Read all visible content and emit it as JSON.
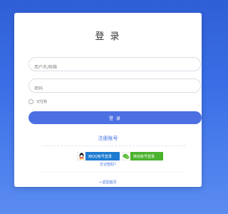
{
  "title": "登 录",
  "username": {
    "placeholder": "用户名/邮箱",
    "value": ""
  },
  "password": {
    "placeholder": "密码",
    "value": ""
  },
  "remember": {
    "label": "记住我"
  },
  "login_button": "登 录",
  "register_link": "注册账号",
  "qq_login": {
    "label": "用QQ帐号登录",
    "icon": "qq-icon"
  },
  "wechat_login": {
    "label": "微信账号登录",
    "icon": "wechat-icon"
  },
  "forgot_link": "忘记密码?",
  "home_link": "←返回首页",
  "colors": {
    "background": "#3b6ee6",
    "primary": "#4c70e2",
    "link": "#3c6fe0",
    "qq": "#1e7bd1",
    "wechat": "#4bb22e"
  }
}
